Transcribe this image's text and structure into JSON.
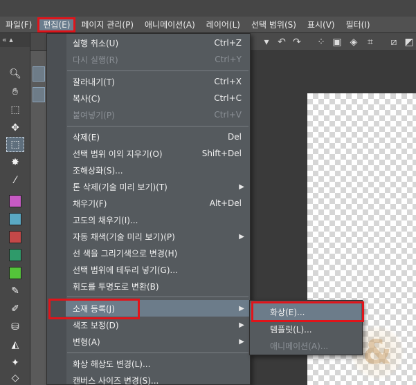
{
  "menubar": {
    "items": [
      {
        "label": "파일(F)"
      },
      {
        "label": "편집(E)"
      },
      {
        "label": "페이지 관리(P)"
      },
      {
        "label": "애니메이션(A)"
      },
      {
        "label": "레이어(L)"
      },
      {
        "label": "선택 범위(S)"
      },
      {
        "label": "표시(V)"
      },
      {
        "label": "필터(I)"
      }
    ],
    "active_index": 1
  },
  "edit_menu": {
    "items": [
      {
        "label": "실행 취소(U)",
        "shortcut": "Ctrl+Z",
        "enabled": true
      },
      {
        "label": "다시 실행(R)",
        "shortcut": "Ctrl+Y",
        "enabled": false
      },
      {
        "label": "잘라내기(T)",
        "shortcut": "Ctrl+X",
        "enabled": true
      },
      {
        "label": "복사(C)",
        "shortcut": "Ctrl+C",
        "enabled": true
      },
      {
        "label": "붙여넣기(P)",
        "shortcut": "Ctrl+V",
        "enabled": false
      },
      {
        "label": "삭제(E)",
        "shortcut": "Del",
        "enabled": true
      },
      {
        "label": "선택 범위 이외 지우기(O)",
        "shortcut": "Shift+Del",
        "enabled": true
      },
      {
        "label": "조해상화(S)...",
        "shortcut": "",
        "enabled": true
      },
      {
        "label": "톤 삭제(기술 미리 보기)(T)",
        "shortcut": "",
        "enabled": true,
        "submenu": true
      },
      {
        "label": "채우기(F)",
        "shortcut": "Alt+Del",
        "enabled": true
      },
      {
        "label": "고도의 채우기(I)...",
        "shortcut": "",
        "enabled": true
      },
      {
        "label": "자동 채색(기술 미리 보기)(P)",
        "shortcut": "",
        "enabled": true,
        "submenu": true
      },
      {
        "label": "선 색을 그리기색으로 변경(H)",
        "shortcut": "",
        "enabled": true
      },
      {
        "label": "선택 범위에 테두리 넣기(G)...",
        "shortcut": "",
        "enabled": true
      },
      {
        "label": "휘도를 투명도로 변환(B)",
        "shortcut": "",
        "enabled": true
      },
      {
        "label": "소재 등록(J)",
        "shortcut": "",
        "enabled": true,
        "submenu": true,
        "highlighted": true
      },
      {
        "label": "색조 보정(D)",
        "shortcut": "",
        "enabled": true,
        "submenu": true
      },
      {
        "label": "변형(A)",
        "shortcut": "",
        "enabled": true,
        "submenu": true
      },
      {
        "label": "화상 해상도 변경(L)...",
        "shortcut": "",
        "enabled": true
      },
      {
        "label": "캔버스 사이즈 변경(S)...",
        "shortcut": "",
        "enabled": true
      }
    ]
  },
  "submenu": {
    "items": [
      {
        "label": "화상(E)...",
        "enabled": true,
        "highlighted": true
      },
      {
        "label": "템플릿(L)...",
        "enabled": true
      },
      {
        "label": "애니메이션(A)...",
        "enabled": false
      }
    ]
  },
  "colors": {
    "menu_bg": "#555a5e",
    "highlight": "#6c7c8a",
    "annotation_red": "#e0141a",
    "disabled_text": "#8b9096"
  }
}
